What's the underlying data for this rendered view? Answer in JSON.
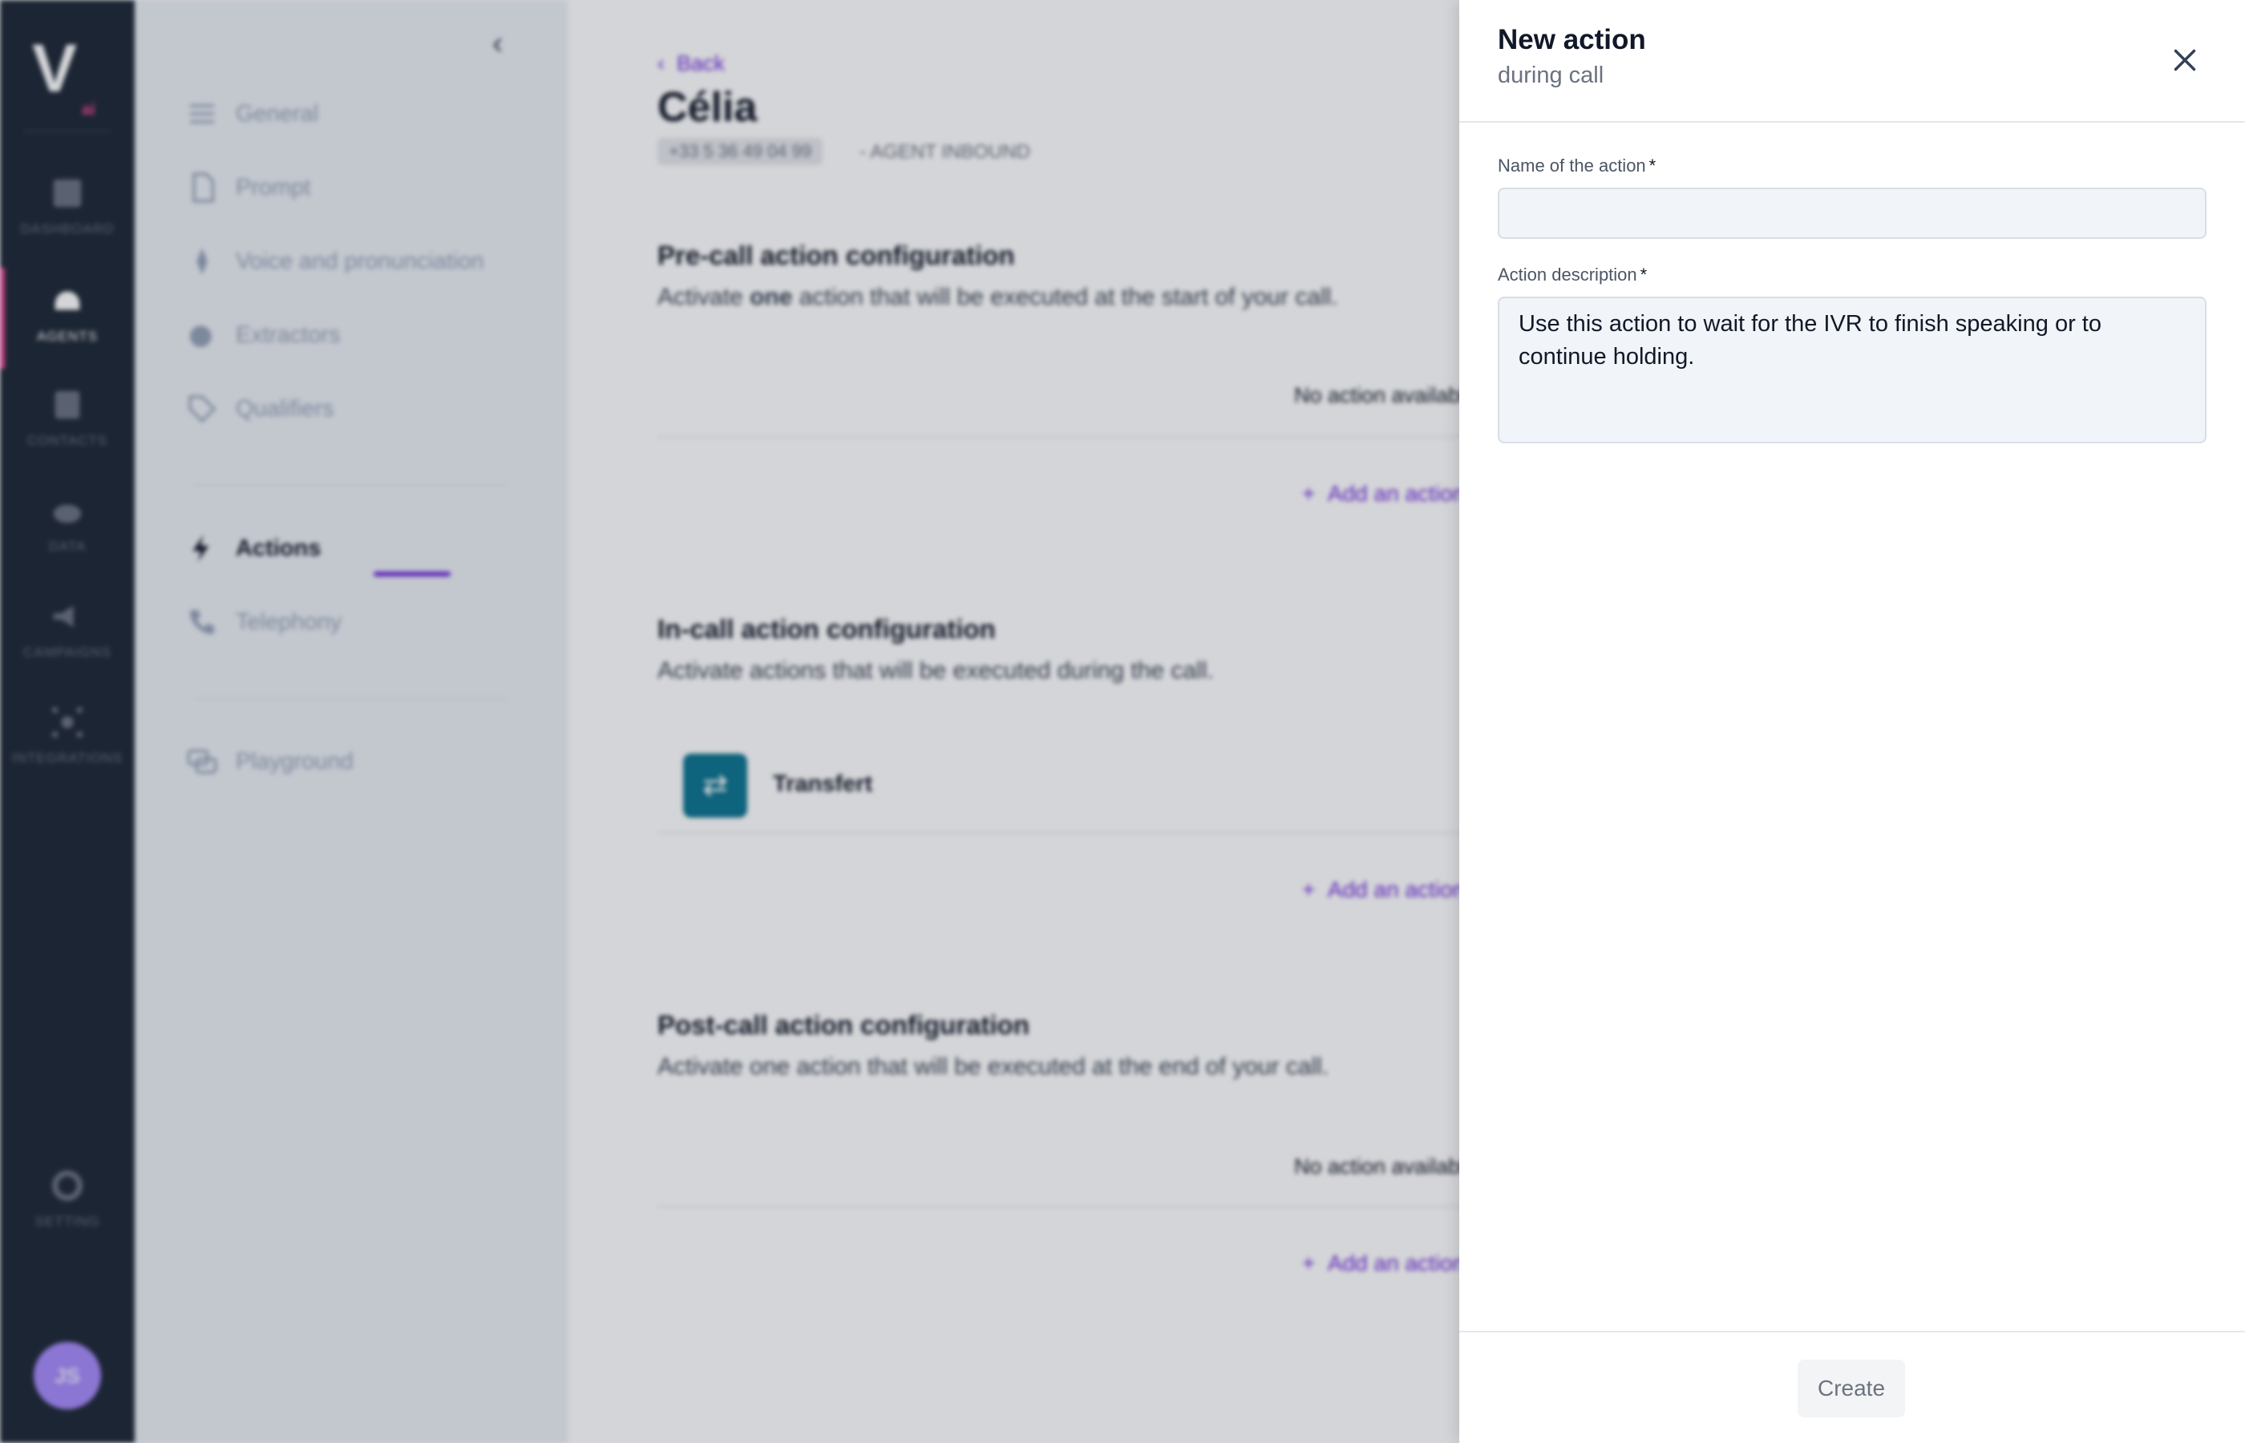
{
  "rail": {
    "logo": "V",
    "logo_mark": "ai",
    "items": [
      {
        "label": "DASHBOARD",
        "icon": "dashboard-icon"
      },
      {
        "label": "AGENTS",
        "icon": "agents-icon"
      },
      {
        "label": "CONTACTS",
        "icon": "contacts-icon"
      },
      {
        "label": "DATA",
        "icon": "cloud-icon"
      },
      {
        "label": "CAMPAIGNS",
        "icon": "megaphone-icon"
      },
      {
        "label": "INTEGRATIONS",
        "icon": "network-icon"
      },
      {
        "label": "SETTING",
        "icon": "gear-icon"
      }
    ],
    "avatar": "JS",
    "accent": "#ec4899"
  },
  "subnav": {
    "items": [
      {
        "label": "General",
        "icon": "sliders-icon"
      },
      {
        "label": "Prompt",
        "icon": "document-icon"
      },
      {
        "label": "Voice and pronunciation",
        "icon": "voice-icon"
      },
      {
        "label": "Extractors",
        "icon": "extractor-icon"
      },
      {
        "label": "Qualifiers",
        "icon": "tag-icon"
      },
      {
        "label": "Actions",
        "icon": "bolt-icon"
      },
      {
        "label": "Telephony",
        "icon": "phone-icon"
      },
      {
        "label": "Playground",
        "icon": "chat-icon"
      }
    ],
    "active": "Actions"
  },
  "main": {
    "back": "Back",
    "title": "Célia",
    "phone": "+33 5 36 49 04 99",
    "agent_type": "- AGENT INBOUND",
    "pre_call": {
      "title": "Pre-call action configuration",
      "desc_before": "Activate ",
      "desc_bold": "one",
      "desc_after": " action that will be executed at the start of your call.",
      "empty": "No action available",
      "add": "Add an action"
    },
    "in_call": {
      "title": "In-call action configuration",
      "desc": "Activate actions that will be executed during the call.",
      "item_label": "Transfert",
      "add": "Add an action"
    },
    "post_call": {
      "title": "Post-call action configuration",
      "desc": "Activate one action that will be executed at the end of your call.",
      "empty": "No action available",
      "add": "Add an action"
    }
  },
  "drawer": {
    "title": "New action",
    "subtitle": "during call",
    "name_label": "Name of the action",
    "name_value": "",
    "description_label": "Action description",
    "required_marker": "*",
    "description_value": "Use this action to wait for the IVR to finish speaking or to continue holding.",
    "create_label": "Create"
  },
  "colors": {
    "brand": "#6d28d9",
    "sidebar": "#1f2937",
    "transfer_icon": "#0e7490"
  }
}
